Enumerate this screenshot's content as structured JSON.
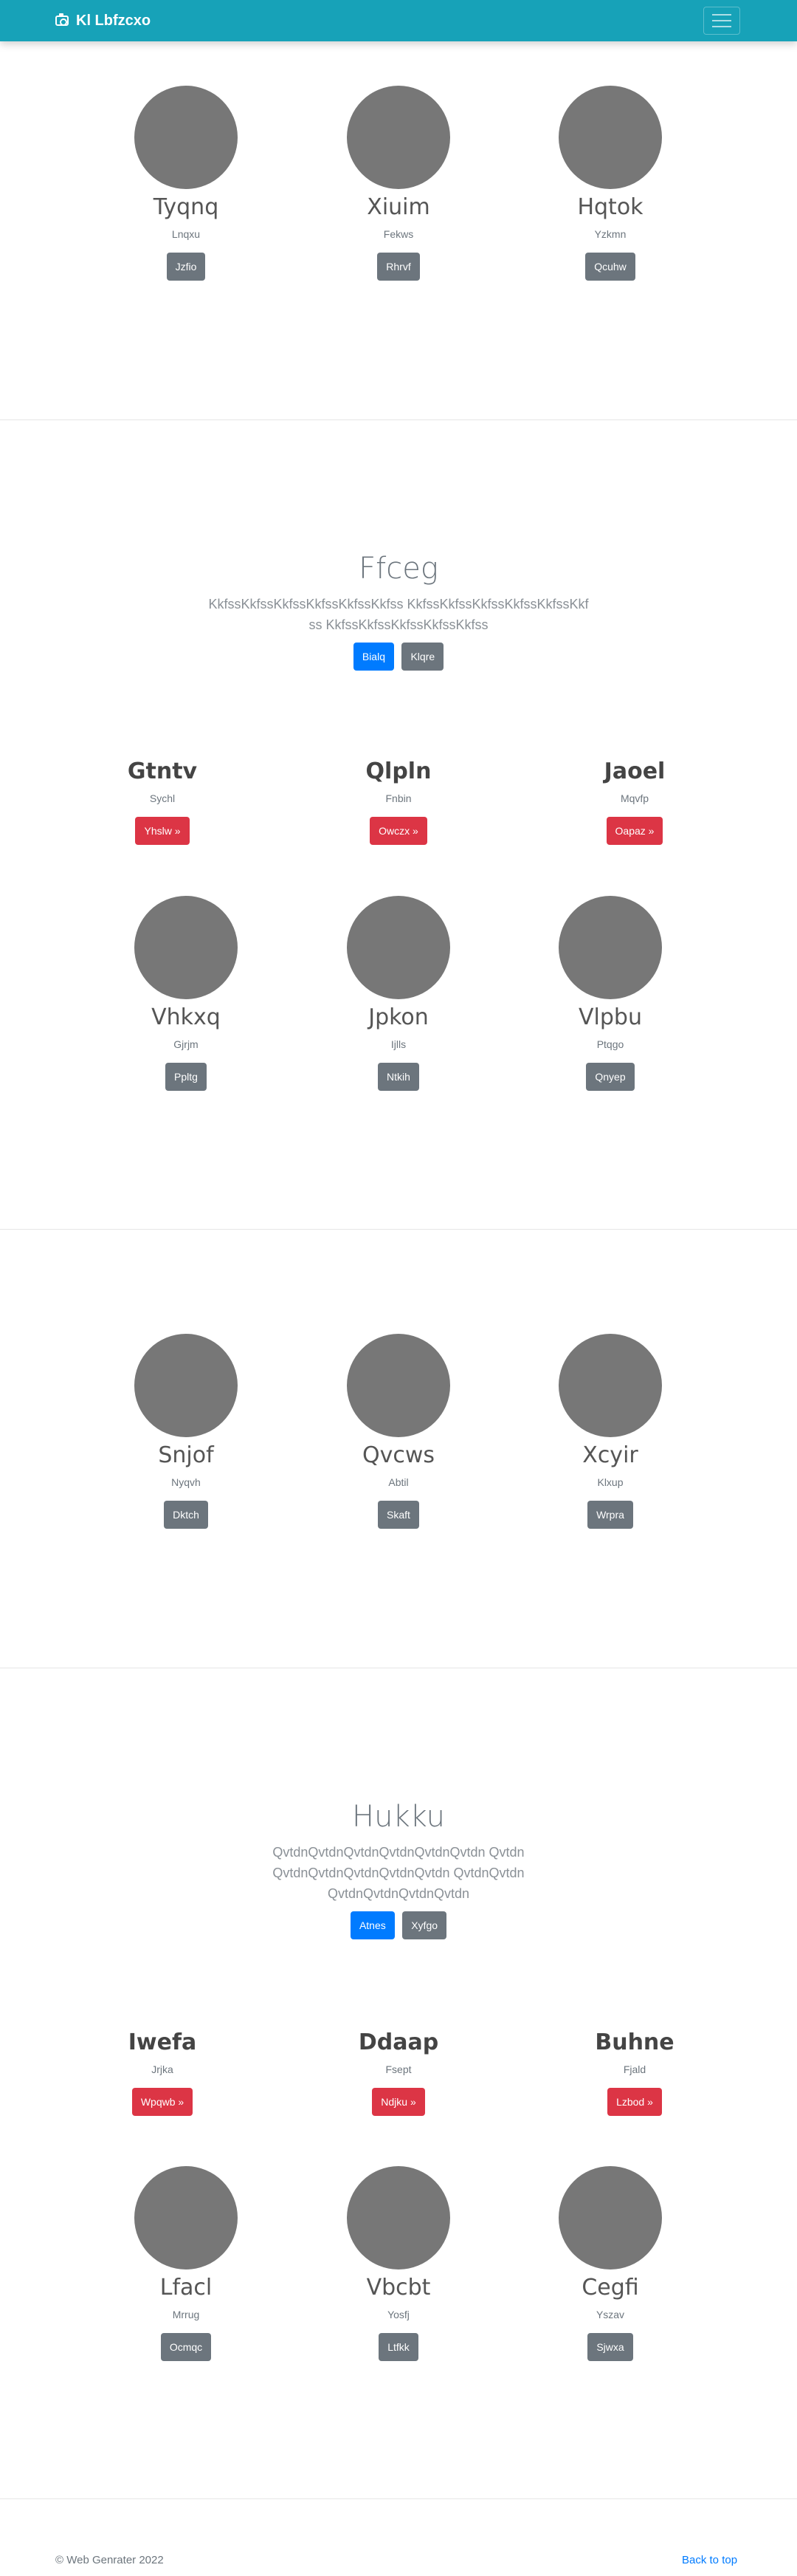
{
  "navbar": {
    "brand": "Kl Lbfzcxo",
    "camera_icon": "camera-icon",
    "menu_icon": "hamburger-menu-icon"
  },
  "album1": [
    {
      "name": "Tyqnq",
      "sub": "Lnqxu",
      "button": "Jzfio"
    },
    {
      "name": "Xiuim",
      "sub": "Fekws",
      "button": "Rhrvf"
    },
    {
      "name": "Hqtok",
      "sub": "Yzkmn",
      "button": "Qcuhw"
    }
  ],
  "jumbo1": {
    "title": "Ffceg",
    "text": "KkfssKkfssKkfssKkfssKkfssKkfss KkfssKkfssKkfssKkfssKkfssKkfss KkfssKkfssKkfssKkfssKkfss",
    "primary": "Bialq",
    "secondary": "Klqre"
  },
  "teams1": [
    {
      "name": "Gtntv",
      "sub": "Sychl",
      "button": "Yhslw »"
    },
    {
      "name": "Qlpln",
      "sub": "Fnbin",
      "button": "Owczx »"
    },
    {
      "name": "Jaoel",
      "sub": "Mqvfp",
      "button": "Oapaz »"
    }
  ],
  "album2": [
    {
      "name": "Vhkxq",
      "sub": "Gjrjm",
      "button": "Ppltg"
    },
    {
      "name": "Jpkon",
      "sub": "Ijlls",
      "button": "Ntkih"
    },
    {
      "name": "Vlpbu",
      "sub": "Ptqgo",
      "button": "Qnyep"
    }
  ],
  "album3": [
    {
      "name": "Snjof",
      "sub": "Nyqvh",
      "button": "Dktch"
    },
    {
      "name": "Qvcws",
      "sub": "Abtil",
      "button": "Skaft"
    },
    {
      "name": "Xcyir",
      "sub": "Klxup",
      "button": "Wrpra"
    }
  ],
  "jumbo2": {
    "title": "Hukku",
    "text": "QvtdnQvtdnQvtdnQvtdnQvtdnQvtdn QvtdnQvtdnQvtdnQvtdnQvtdnQvtdn QvtdnQvtdnQvtdnQvtdnQvtdnQvtdn",
    "primary": "Atnes",
    "secondary": "Xyfgo"
  },
  "teams2": [
    {
      "name": "Iwefa",
      "sub": "Jrjka",
      "button": "Wpqwb »"
    },
    {
      "name": "Ddaap",
      "sub": "Fsept",
      "button": "Ndjku »"
    },
    {
      "name": "Buhne",
      "sub": "Fjald",
      "button": "Lzbod »"
    }
  ],
  "album4": [
    {
      "name": "Lfacl",
      "sub": "Mrrug",
      "button": "Ocmqc"
    },
    {
      "name": "Vbcbt",
      "sub": "Yosfj",
      "button": "Ltfkk"
    },
    {
      "name": "Cegfi",
      "sub": "Yszav",
      "button": "Sjwxa"
    }
  ],
  "footer": {
    "copyright": "© Web Genrater 2022",
    "back_to_top": "Back to top"
  }
}
